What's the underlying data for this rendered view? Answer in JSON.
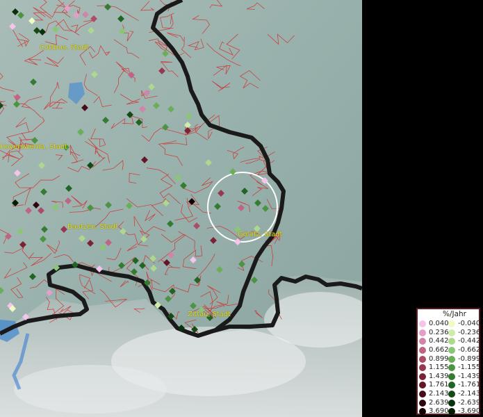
{
  "map": {
    "cities": [
      {
        "name": "Cottbus, Stadt"
      },
      {
        "name": "Hoyerswerda, Stadt"
      },
      {
        "name": "Bautzen, Stadt"
      },
      {
        "name": "Görlitz, Stadt"
      },
      {
        "name": "Zittau, Stadt"
      }
    ],
    "colors": {
      "background": "#000000",
      "district_border": "#d03030",
      "national_border": "#111111",
      "label": "#e8e020",
      "highlight_ring": "#ffffff"
    }
  },
  "legend": {
    "title": "%/Jahr",
    "positive": [
      {
        "label": "0.040",
        "color": "#f4c4ec"
      },
      {
        "label": "0.236",
        "color": "#e2a0c8"
      },
      {
        "label": "0.442",
        "color": "#d084a8"
      },
      {
        "label": "0.662",
        "color": "#bf6484"
      },
      {
        "label": "0.899",
        "color": "#ad4c68"
      },
      {
        "label": "1.155",
        "color": "#963850"
      },
      {
        "label": "1.439",
        "color": "#7c2236"
      },
      {
        "label": "1.761",
        "color": "#621626"
      },
      {
        "label": "2.143",
        "color": "#480c18"
      },
      {
        "label": "2.639",
        "color": "#2e060e"
      },
      {
        "label": "3.690",
        "color": "#140004"
      }
    ],
    "negative": [
      {
        "label": "-0.040",
        "color": "#f0fac4"
      },
      {
        "label": "-0.236",
        "color": "#cfeca8"
      },
      {
        "label": "-0.442",
        "color": "#aed890"
      },
      {
        "label": "-0.662",
        "color": "#8cc478"
      },
      {
        "label": "-0.899",
        "color": "#6aae5c"
      },
      {
        "label": "-1.155",
        "color": "#4c9444"
      },
      {
        "label": "-1.439",
        "color": "#347c30"
      },
      {
        "label": "-1.761",
        "color": "#226424"
      },
      {
        "label": "-2.143",
        "color": "#134a16"
      },
      {
        "label": "-2.639",
        "color": "#08320c"
      },
      {
        "label": "-3.690",
        "color": "#021c04"
      }
    ]
  }
}
